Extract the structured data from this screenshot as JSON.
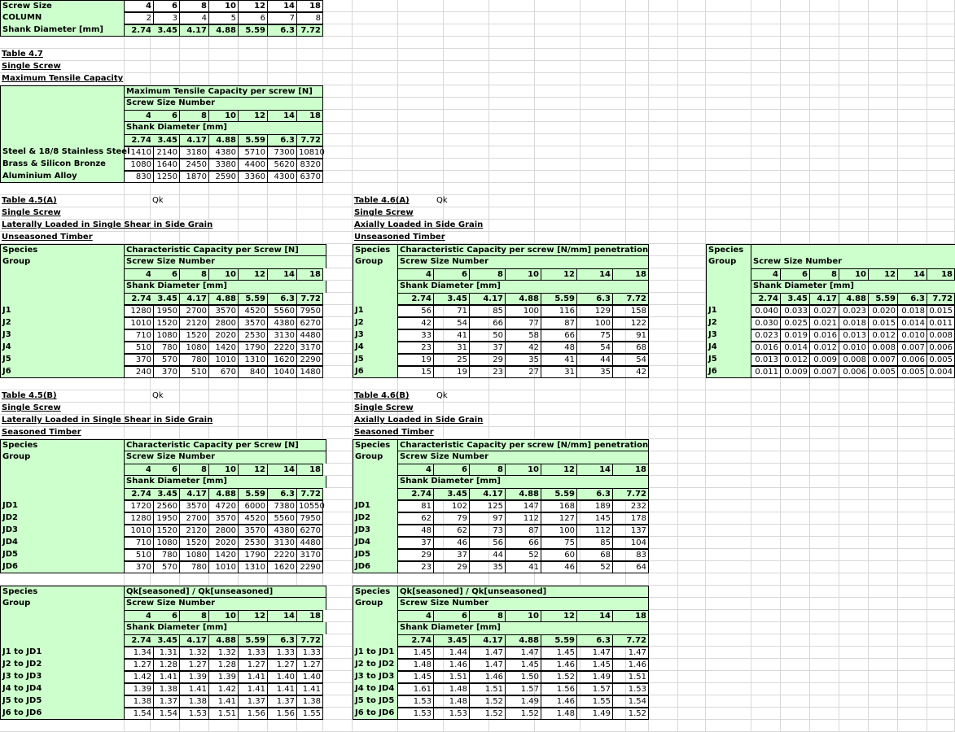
{
  "screw_sizes": [
    "4",
    "6",
    "8",
    "10",
    "12",
    "14",
    "18"
  ],
  "top": {
    "rows": [
      {
        "label": "Screw Size",
        "values": [
          "4",
          "6",
          "8",
          "10",
          "12",
          "14",
          "18"
        ]
      },
      {
        "label": "COLUMN",
        "values": [
          "2",
          "3",
          "4",
          "5",
          "6",
          "7",
          "8"
        ]
      },
      {
        "label": "Shank Diameter [mm]",
        "values": [
          "2.74",
          "3.45",
          "4.17",
          "4.88",
          "5.59",
          "6.3",
          "7.72"
        ]
      }
    ]
  },
  "t47": {
    "title": [
      "Table 4.7",
      "Single Screw",
      "Maximum Tensile Capacity"
    ],
    "h1": "Maximum Tensile Capacity per screw [N]",
    "h2": "Screw Size Number",
    "h3": "Shank Diameter [mm]",
    "sizes": [
      "4",
      "6",
      "8",
      "10",
      "12",
      "14",
      "18"
    ],
    "diam": [
      "2.74",
      "3.45",
      "4.17",
      "4.88",
      "5.59",
      "6.3",
      "7.72"
    ],
    "rows": [
      {
        "label": "Steel & 18/8 Stainless Steel",
        "values": [
          "1410",
          "2140",
          "3180",
          "4380",
          "5710",
          "7300",
          "10810"
        ]
      },
      {
        "label": "Brass & Silicon Bronze",
        "values": [
          "1080",
          "1640",
          "2450",
          "3380",
          "4400",
          "5620",
          "8320"
        ]
      },
      {
        "label": "Aluminium Alloy",
        "values": [
          "830",
          "1250",
          "1870",
          "2590",
          "3360",
          "4300",
          "6370"
        ]
      }
    ]
  },
  "t45a": {
    "title": [
      "Table 4.5(A)",
      "Single Screw",
      "Laterally Loaded in Single  Shear in Side Grain",
      "Unseasoned Timber"
    ],
    "qk": "Qk",
    "species": "Species",
    "group": "Group",
    "h1": "Characteristic Capacity per Screw [N]",
    "h2": "Screw Size Number",
    "h3": "Shank Diameter [mm]",
    "sizes": [
      "4",
      "6",
      "8",
      "10",
      "12",
      "14",
      "18"
    ],
    "diam": [
      "2.74",
      "3.45",
      "4.17",
      "4.88",
      "5.59",
      "6.3",
      "7.72"
    ],
    "rows": [
      {
        "label": "J1",
        "values": [
          "1280",
          "1950",
          "2700",
          "3570",
          "4520",
          "5560",
          "7950"
        ]
      },
      {
        "label": "J2",
        "values": [
          "1010",
          "1520",
          "2120",
          "2800",
          "3570",
          "4380",
          "6270"
        ]
      },
      {
        "label": "J3",
        "values": [
          "710",
          "1080",
          "1520",
          "2020",
          "2530",
          "3130",
          "4480"
        ]
      },
      {
        "label": "J4",
        "values": [
          "510",
          "780",
          "1080",
          "1420",
          "1790",
          "2220",
          "3170"
        ]
      },
      {
        "label": "J5",
        "values": [
          "370",
          "570",
          "780",
          "1010",
          "1310",
          "1620",
          "2290"
        ]
      },
      {
        "label": "J6",
        "values": [
          "240",
          "370",
          "510",
          "670",
          "840",
          "1040",
          "1480"
        ]
      }
    ]
  },
  "t46a": {
    "title": [
      "Table 4.6(A)",
      "Single Screw",
      "Axially Loaded in Side Grain",
      "Unseasoned Timber"
    ],
    "qk": "Qk",
    "species": "Species",
    "group": "Group",
    "h1": "Characteristic Capacity per screw [N/mm] penetration",
    "h2": "Screw Size Number",
    "h3": "Shank Diameter [mm]",
    "sizes": [
      "4",
      "6",
      "8",
      "10",
      "12",
      "14",
      "18"
    ],
    "diam": [
      "2.74",
      "3.45",
      "4.17",
      "4.88",
      "5.59",
      "6.3",
      "7.72"
    ],
    "rows": [
      {
        "label": "J1",
        "values": [
          "56",
          "71",
          "85",
          "100",
          "116",
          "129",
          "158"
        ]
      },
      {
        "label": "J2",
        "values": [
          "42",
          "54",
          "66",
          "77",
          "87",
          "100",
          "122"
        ]
      },
      {
        "label": "J3",
        "values": [
          "33",
          "41",
          "50",
          "58",
          "66",
          "75",
          "91"
        ]
      },
      {
        "label": "J4",
        "values": [
          "23",
          "31",
          "37",
          "42",
          "48",
          "54",
          "68"
        ]
      },
      {
        "label": "J5",
        "values": [
          "19",
          "25",
          "29",
          "35",
          "41",
          "44",
          "54"
        ]
      },
      {
        "label": "J6",
        "values": [
          "15",
          "19",
          "23",
          "27",
          "31",
          "35",
          "42"
        ]
      }
    ]
  },
  "t46r": {
    "species": "Species",
    "group": "Group",
    "h2": "Screw Size Number",
    "h3": "Shank Diameter [mm]",
    "sizes": [
      "4",
      "6",
      "8",
      "10",
      "12",
      "14",
      "18"
    ],
    "diam": [
      "2.74",
      "3.45",
      "4.17",
      "4.88",
      "5.59",
      "6.3",
      "7.72"
    ],
    "rows": [
      {
        "label": "J1",
        "values": [
          "0.040",
          "0.033",
          "0.027",
          "0.023",
          "0.020",
          "0.018",
          "0.015"
        ]
      },
      {
        "label": "J2",
        "values": [
          "0.030",
          "0.025",
          "0.021",
          "0.018",
          "0.015",
          "0.014",
          "0.011"
        ]
      },
      {
        "label": "J3",
        "values": [
          "0.023",
          "0.019",
          "0.016",
          "0.013",
          "0.012",
          "0.010",
          "0.008"
        ]
      },
      {
        "label": "J4",
        "values": [
          "0.016",
          "0.014",
          "0.012",
          "0.010",
          "0.008",
          "0.007",
          "0.006"
        ]
      },
      {
        "label": "J5",
        "values": [
          "0.013",
          "0.012",
          "0.009",
          "0.008",
          "0.007",
          "0.006",
          "0.005"
        ]
      },
      {
        "label": "J6",
        "values": [
          "0.011",
          "0.009",
          "0.007",
          "0.006",
          "0.005",
          "0.005",
          "0.004"
        ]
      }
    ]
  },
  "t45b": {
    "title": [
      "Table 4.5(B)",
      "Single Screw",
      "Laterally Loaded in Single  Shear in Side Grain",
      "Seasoned Timber"
    ],
    "qk": "Qk",
    "species": "Species",
    "group": "Group",
    "h1": "Characteristic Capacity per Screw [N]",
    "h2": "Screw Size Number",
    "h3": "Shank Diameter [mm]",
    "sizes": [
      "4",
      "6",
      "8",
      "10",
      "12",
      "14",
      "18"
    ],
    "diam": [
      "2.74",
      "3.45",
      "4.17",
      "4.88",
      "5.59",
      "6.3",
      "7.72"
    ],
    "rows": [
      {
        "label": "JD1",
        "values": [
          "1720",
          "2560",
          "3570",
          "4720",
          "6000",
          "7380",
          "10550"
        ]
      },
      {
        "label": "JD2",
        "values": [
          "1280",
          "1950",
          "2700",
          "3570",
          "4520",
          "5560",
          "7950"
        ]
      },
      {
        "label": "JD3",
        "values": [
          "1010",
          "1520",
          "2120",
          "2800",
          "3570",
          "4380",
          "6270"
        ]
      },
      {
        "label": "JD4",
        "values": [
          "710",
          "1080",
          "1520",
          "2020",
          "2530",
          "3130",
          "4480"
        ]
      },
      {
        "label": "JD5",
        "values": [
          "510",
          "780",
          "1080",
          "1420",
          "1790",
          "2220",
          "3170"
        ]
      },
      {
        "label": "JD6",
        "values": [
          "370",
          "570",
          "780",
          "1010",
          "1310",
          "1620",
          "2290"
        ]
      }
    ]
  },
  "t46b": {
    "title": [
      "Table 4.6(B)",
      "Single Screw",
      "Axially Loaded in Side Grain",
      "Seasoned Timber"
    ],
    "qk": "Qk",
    "species": "Species",
    "group": "Group",
    "h1": "Characteristic Capacity per screw [N/mm] penetration",
    "h2": "Screw Size Number",
    "h3": "Shank Diameter [mm]",
    "sizes": [
      "4",
      "6",
      "8",
      "10",
      "12",
      "14",
      "18"
    ],
    "diam": [
      "2.74",
      "3.45",
      "4.17",
      "4.88",
      "5.59",
      "6.3",
      "7.72"
    ],
    "rows": [
      {
        "label": "JD1",
        "values": [
          "81",
          "102",
          "125",
          "147",
          "168",
          "189",
          "232"
        ]
      },
      {
        "label": "JD2",
        "values": [
          "62",
          "79",
          "97",
          "112",
          "127",
          "145",
          "178"
        ]
      },
      {
        "label": "JD3",
        "values": [
          "48",
          "62",
          "73",
          "87",
          "100",
          "112",
          "137"
        ]
      },
      {
        "label": "JD4",
        "values": [
          "37",
          "46",
          "56",
          "66",
          "75",
          "85",
          "104"
        ]
      },
      {
        "label": "JD5",
        "values": [
          "29",
          "37",
          "44",
          "52",
          "60",
          "68",
          "83"
        ]
      },
      {
        "label": "JD6",
        "values": [
          "23",
          "29",
          "35",
          "41",
          "46",
          "52",
          "64"
        ]
      }
    ]
  },
  "tra": {
    "species": "Species",
    "group": "Group",
    "h1": "Qk[seasoned] / Qk[unseasoned]",
    "h2": "Screw Size Number",
    "h3": "Shank Diameter [mm]",
    "sizes": [
      "4",
      "6",
      "8",
      "10",
      "12",
      "14",
      "18"
    ],
    "diam": [
      "2.74",
      "3.45",
      "4.17",
      "4.88",
      "5.59",
      "6.3",
      "7.72"
    ],
    "rows": [
      {
        "label": "J1 to JD1",
        "values": [
          "1.34",
          "1.31",
          "1.32",
          "1.32",
          "1.33",
          "1.33",
          "1.33"
        ]
      },
      {
        "label": "J2 to JD2",
        "values": [
          "1.27",
          "1.28",
          "1.27",
          "1.28",
          "1.27",
          "1.27",
          "1.27"
        ]
      },
      {
        "label": "J3 to JD3",
        "values": [
          "1.42",
          "1.41",
          "1.39",
          "1.39",
          "1.41",
          "1.40",
          "1.40"
        ]
      },
      {
        "label": "J4 to JD4",
        "values": [
          "1.39",
          "1.38",
          "1.41",
          "1.42",
          "1.41",
          "1.41",
          "1.41"
        ]
      },
      {
        "label": "J5 to JD5",
        "values": [
          "1.38",
          "1.37",
          "1.38",
          "1.41",
          "1.37",
          "1.37",
          "1.38"
        ]
      },
      {
        "label": "J6 to JD6",
        "values": [
          "1.54",
          "1.54",
          "1.53",
          "1.51",
          "1.56",
          "1.56",
          "1.55"
        ]
      }
    ]
  },
  "trb": {
    "species": "Species",
    "group": "Group",
    "h1": "Qk[seasoned] / Qk[unseasoned]",
    "h2": "Screw Size Number",
    "h3": "Shank Diameter [mm]",
    "sizes": [
      "4",
      "6",
      "8",
      "10",
      "12",
      "14",
      "18"
    ],
    "diam": [
      "2.74",
      "3.45",
      "4.17",
      "4.88",
      "5.59",
      "6.3",
      "7.72"
    ],
    "rows": [
      {
        "label": "J1 to JD1",
        "values": [
          "1.45",
          "1.44",
          "1.47",
          "1.47",
          "1.45",
          "1.47",
          "1.47"
        ]
      },
      {
        "label": "J2 to JD2",
        "values": [
          "1.48",
          "1.46",
          "1.47",
          "1.45",
          "1.46",
          "1.45",
          "1.46"
        ]
      },
      {
        "label": "J3 to JD3",
        "values": [
          "1.45",
          "1.51",
          "1.46",
          "1.50",
          "1.52",
          "1.49",
          "1.51"
        ]
      },
      {
        "label": "J4 to JD4",
        "values": [
          "1.61",
          "1.48",
          "1.51",
          "1.57",
          "1.56",
          "1.57",
          "1.53"
        ]
      },
      {
        "label": "J5 to JD5",
        "values": [
          "1.53",
          "1.48",
          "1.52",
          "1.49",
          "1.46",
          "1.55",
          "1.54"
        ]
      },
      {
        "label": "J6 to JD6",
        "values": [
          "1.53",
          "1.53",
          "1.52",
          "1.52",
          "1.48",
          "1.49",
          "1.52"
        ]
      }
    ]
  }
}
